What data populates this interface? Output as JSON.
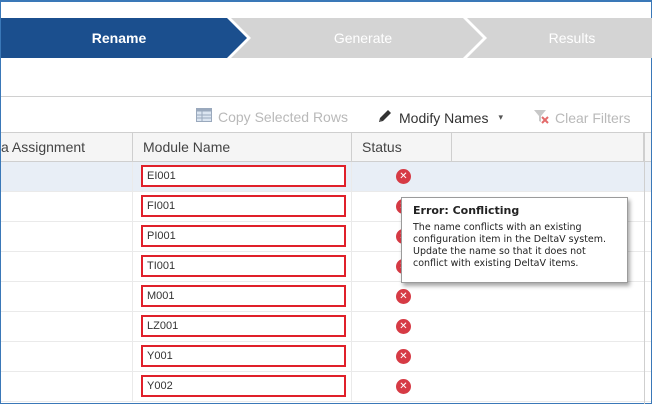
{
  "wizard": {
    "steps": [
      {
        "label": "Rename",
        "state": "active"
      },
      {
        "label": "Generate",
        "state": "inactive"
      },
      {
        "label": "Results",
        "state": "inactive"
      }
    ]
  },
  "toolbar": {
    "copy_label": "Copy Selected Rows",
    "copy_icon": "table-copy-icon",
    "modify_label": "Modify Names",
    "modify_icon": "pencil-icon",
    "modify_caret": "▾",
    "clear_label": "Clear Filters",
    "clear_icon": "filter-clear-icon"
  },
  "grid": {
    "columns": [
      "a Assignment",
      "Module Name",
      "Status"
    ],
    "rows": [
      {
        "module_name": "EI001",
        "status": "error"
      },
      {
        "module_name": "FI001",
        "status": "error"
      },
      {
        "module_name": "PI001",
        "status": "error"
      },
      {
        "module_name": "TI001",
        "status": "error"
      },
      {
        "module_name": "M001",
        "status": "error"
      },
      {
        "module_name": "LZ001",
        "status": "error"
      },
      {
        "module_name": "Y001",
        "status": "error"
      },
      {
        "module_name": "Y002",
        "status": "error"
      }
    ]
  },
  "tooltip": {
    "title": "Error: Conflicting",
    "body": "The name conflicts with an existing configuration item in the DeltaV system. Update the name so that it does not conflict with existing DeltaV items."
  },
  "colors": {
    "active_step": "#1b4f8e",
    "inactive_step": "#d4d4d4",
    "error": "#d63b45",
    "error_border": "#e0202a",
    "selected_row": "#e8eef6"
  }
}
